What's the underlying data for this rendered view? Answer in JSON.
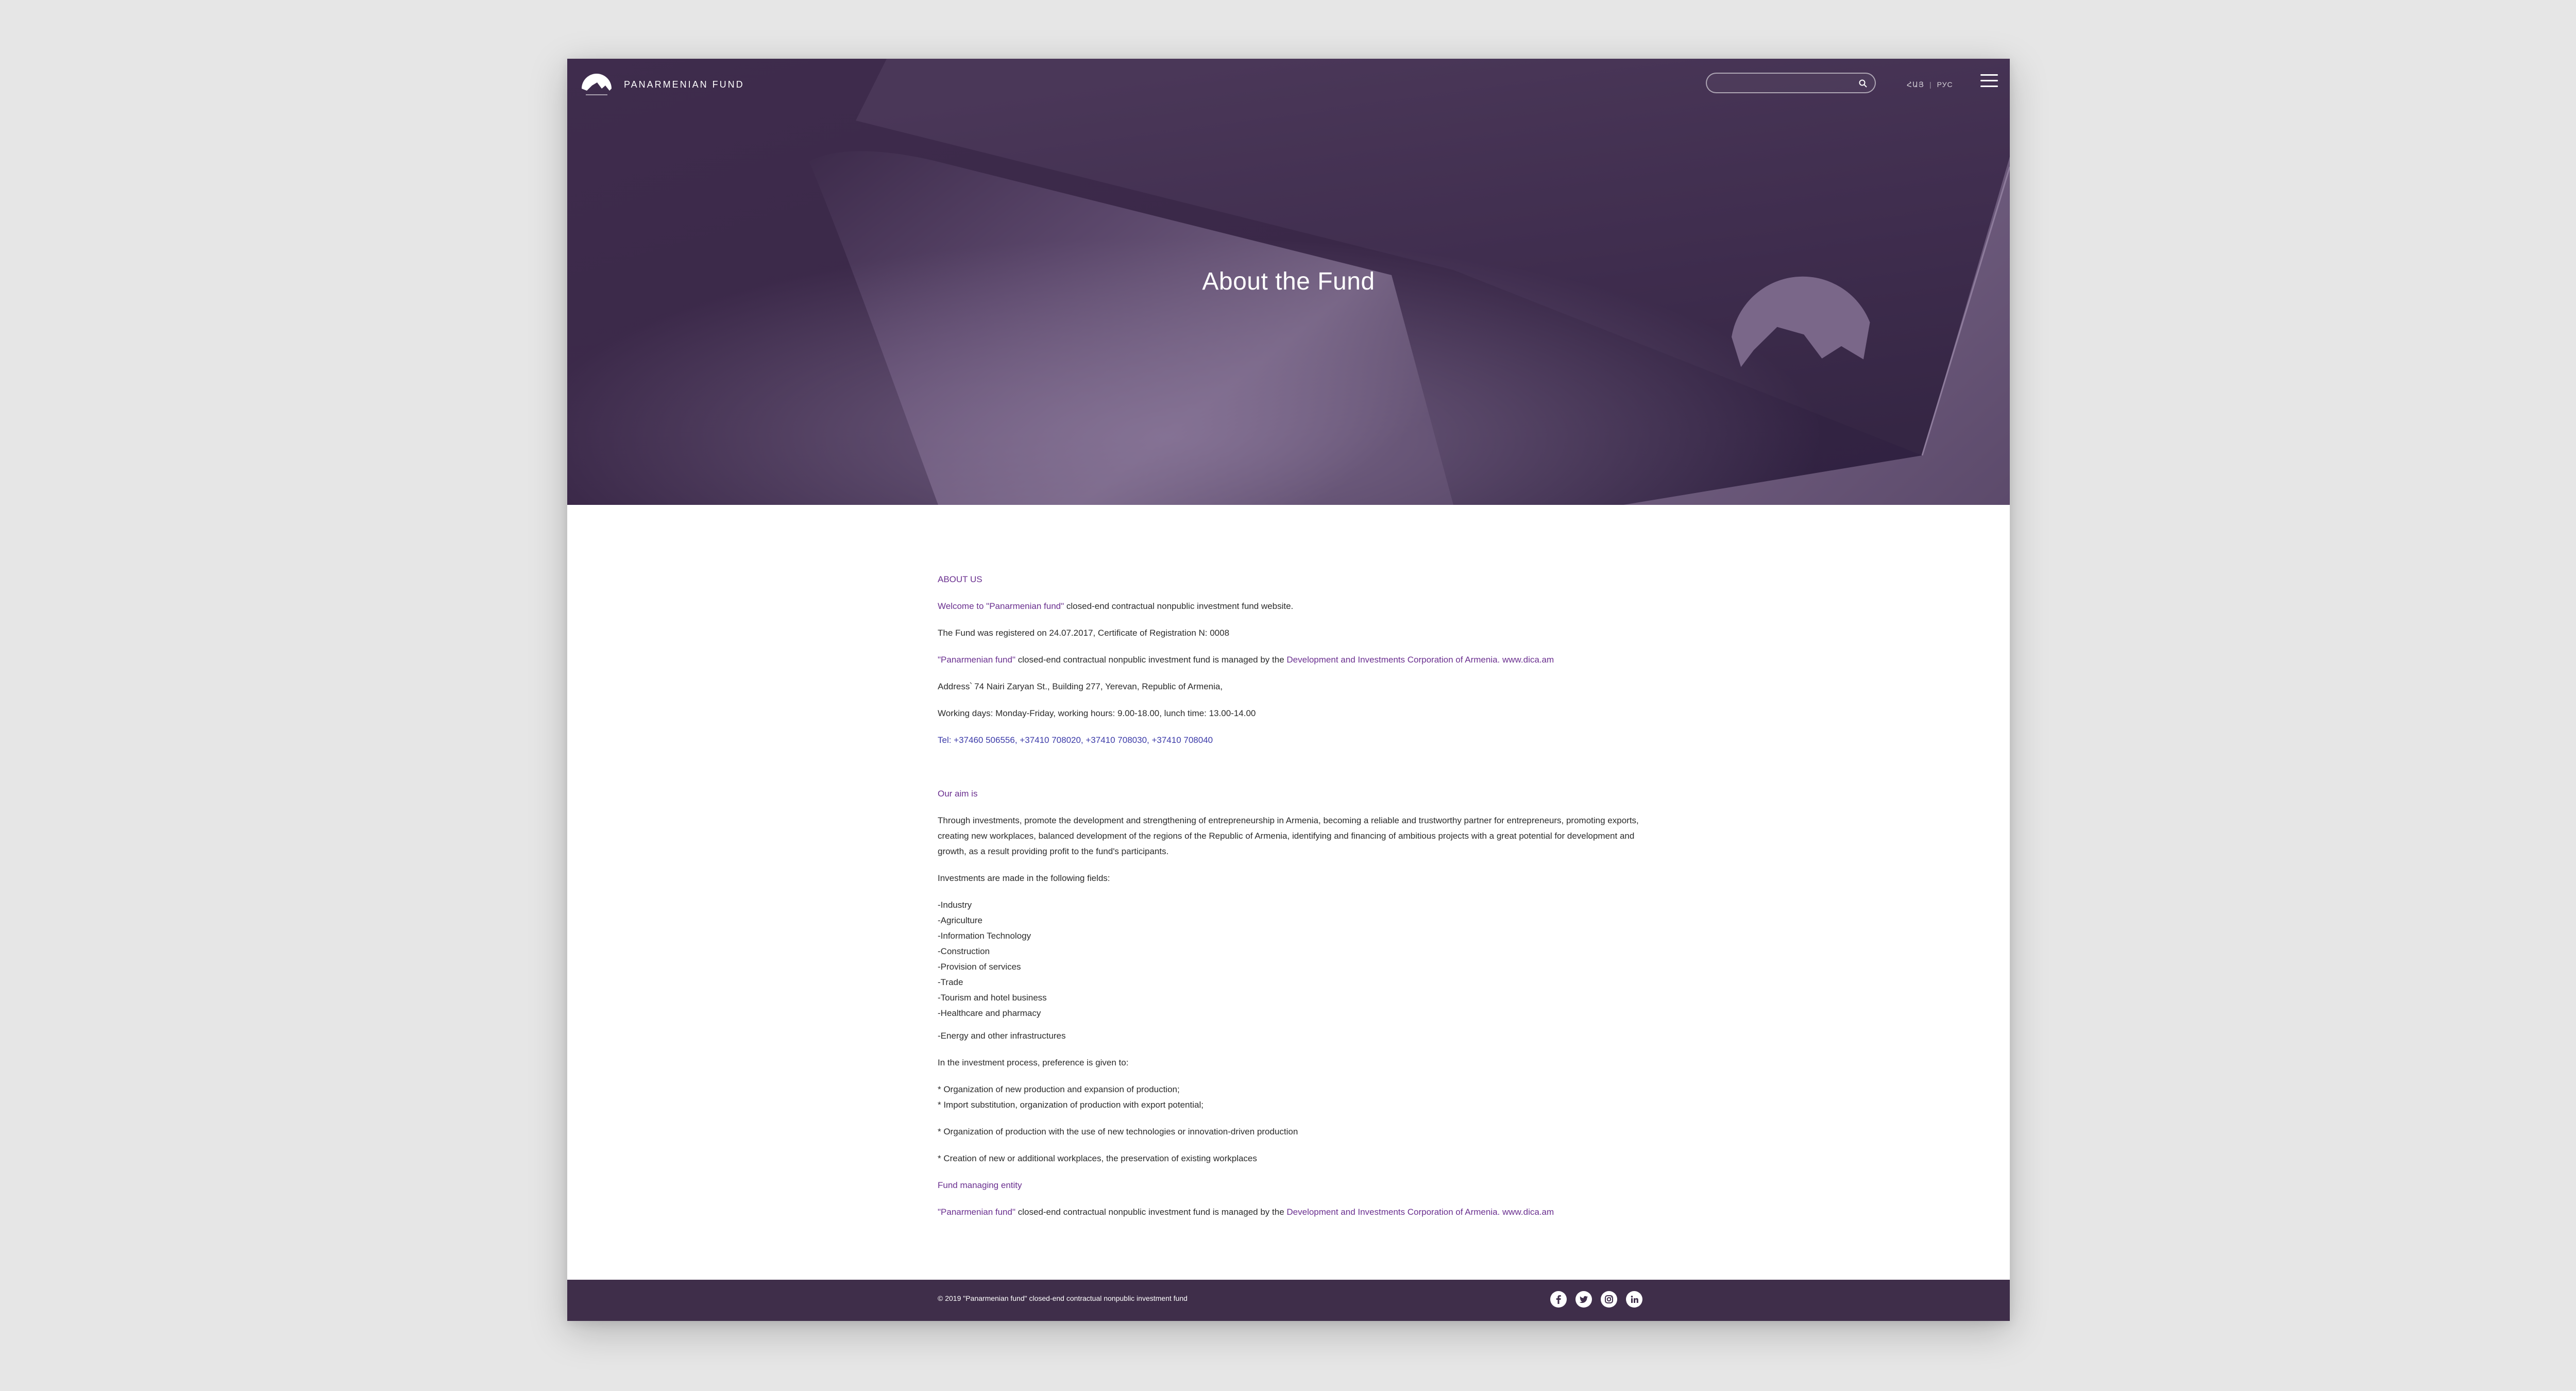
{
  "header": {
    "brand_name": "PANARMENIAN FUND",
    "search_placeholder": "",
    "languages": [
      "ՀԱՅ",
      "РУС"
    ],
    "logo_text": "PANARMENIAN FUND"
  },
  "hero": {
    "title": "About the Fund"
  },
  "about": {
    "heading": "ABOUT US",
    "welcome_link": "Welcome to \"Panarmenian fund\"",
    "welcome_rest": " closed-end contractual nonpublic investment fund website.",
    "registered": "The Fund was registered on 24.07.2017, Certificate of Registration N: 0008",
    "managed_fund": "\"Panarmenian fund\"",
    "managed_mid": " closed-end contractual nonpublic investment fund is managed by the ",
    "managed_corp": "Development and Investments Corporation of Armenia. www.dica.am",
    "address": "Address՝ 74 Nairi Zaryan St., Building 277, Yerevan, Republic of Armenia,",
    "working": "Working days: Monday-Friday, working hours: 9.00-18.00, lunch time: 13.00-14.00",
    "tel": "Tel: +37460 506556, +37410 708020, +37410 708030, +37410 708040"
  },
  "aim": {
    "heading": "Our aim is",
    "text": "Through investments, promote the development and strengthening of entrepreneurship in Armenia, becoming a reliable and trustworthy partner for entrepreneurs, promoting exports, creating new workplaces, balanced development of the regions of the Republic of Armenia, identifying and financing of ambitious projects with a great potential for development and growth, as a result providing profit to the fund's participants.",
    "fields_intro": "Investments are made in the following fields:",
    "fields": [
      "-Industry",
      "-Agriculture",
      "-Information Technology",
      "-Construction",
      "-Provision of services",
      "-Trade",
      "-Tourism and hotel business",
      "-Healthcare and pharmacy"
    ],
    "energy": "-Energy and other infrastructures",
    "preference_intro": "In the investment process, preference is given to:",
    "pref_1": "* Organization of new production and expansion of production;",
    "pref_2": "* Import substitution, organization of production with export potential;",
    "pref_3": "* Organization of production with the use of new technologies or innovation-driven production",
    "pref_4": "* Creation of new or additional workplaces, the preservation of existing workplaces"
  },
  "managing": {
    "heading": "Fund managing entity",
    "fund": "\"Panarmenian fund\"",
    "mid": " closed-end contractual nonpublic investment fund is managed by the ",
    "corp": "Development and Investments Corporation of Armenia. www.dica.am"
  },
  "footer": {
    "copyright": "© 2019 \"Panarmenian fund\" closed-end contractual nonpublic investment fund",
    "socials": [
      "facebook-icon",
      "twitter-icon",
      "instagram-icon",
      "linkedin-icon"
    ]
  },
  "colors": {
    "hero_bg": "#3b2a4a",
    "accent": "#6a2f8f",
    "phone_link": "#3b3aa8",
    "footer_bg": "#3f2e4a"
  }
}
